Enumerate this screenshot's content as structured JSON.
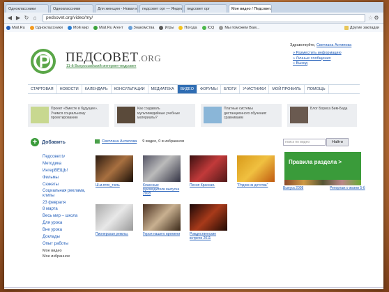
{
  "browser": {
    "tabs": [
      {
        "label": "Одноклассники",
        "active": false
      },
      {
        "label": "Одноклассники",
        "active": false
      },
      {
        "label": "Для женщин - Новая косм",
        "active": false
      },
      {
        "label": "педсовет орг — Яндекс н",
        "active": false
      },
      {
        "label": "педсовет орг",
        "active": false
      },
      {
        "label": "Мое видео / Педсовет.tv",
        "active": true
      }
    ],
    "url": "pedsovet.org/video/my/",
    "bookmarks": [
      "Mail.Ru",
      "Одноклассники",
      "Мой мир",
      "Mail.Ru Агент",
      "Знакомства",
      "Игры",
      "Погода",
      "ICQ",
      "Мы поможем Вам..."
    ],
    "other_bookmarks": "Другие закладки"
  },
  "site": {
    "title": "ПЕДСОВЕТ",
    "title_suffix": ".ORG",
    "tagline": "11-й Всероссийский интернет-педсовет",
    "hello_prefix": "Здравствуйте,",
    "hello_user": "Светлана Антипова",
    "user_links": [
      "Разместить информацию",
      "Личные сообщения",
      "Выход"
    ]
  },
  "nav": [
    {
      "label": "СТАРТОВАЯ",
      "active": false
    },
    {
      "label": "НОВОСТИ",
      "active": false
    },
    {
      "label": "КАЛЕНДАРЬ",
      "active": false
    },
    {
      "label": "КОНСУЛЬТАЦИИ",
      "active": false
    },
    {
      "label": "МЕДИАТЕКА",
      "active": false
    },
    {
      "label": "ВИДЕО",
      "active": true
    },
    {
      "label": "ФОРУМЫ",
      "active": false
    },
    {
      "label": "БЛОГИ",
      "active": false
    },
    {
      "label": "УЧАСТНИКИ",
      "active": false
    },
    {
      "label": "МОЙ ПРОФИЛЬ",
      "active": false
    },
    {
      "label": "ПОМОЩЬ",
      "active": false
    }
  ],
  "promos": [
    {
      "text": "Проект «Вместе в будущее». Учимся социальному проектированию"
    },
    {
      "text": "Как создавать мультимедийные учебные материалы?"
    },
    {
      "text": "Платные системы дистанционного обучения: сравниваем"
    },
    {
      "text": "Блог Бориса Бим-Бада"
    }
  ],
  "sidebar": {
    "add_label": "Добавить",
    "items": [
      "Педсовет.tv",
      "Методика",
      "ИнтерВЕЩЬ!",
      "Фильмы",
      "Сюжеты",
      "Социальная реклама, клипы",
      "23 февраля",
      "8 марта",
      "Весь мир – школа",
      "Для урока",
      "Вне урока",
      "Доклады",
      "Опыт работы"
    ],
    "plain_items": [
      "Мое видео",
      "Мое избранное"
    ]
  },
  "userbar": {
    "name": "Светлана Антипова",
    "stats": "9 видео, 0 в избранном"
  },
  "search": {
    "placeholder": "поиск по видео",
    "button": "Найти"
  },
  "videos": [
    {
      "caption": "Ш.м.пгпх_тюль"
    },
    {
      "caption": "Классные руководители выпуска 2008"
    },
    {
      "caption": "Песня Красная."
    },
    {
      "caption": "\"Рядом из детства\""
    },
    {
      "caption": "Выпуск 2008"
    },
    {
      "caption": "Репортаж о жизни 5-б"
    },
    {
      "caption": "Пионерская рекклы."
    },
    {
      "caption": "Герои нашего времени"
    },
    {
      "caption": "Рождественские встречи 2011"
    }
  ],
  "rules": {
    "label": "Правила раздела >"
  },
  "colors": {
    "brand_green": "#5aa648",
    "nav_active": "#2f6db3",
    "link": "#1e5bb8"
  }
}
